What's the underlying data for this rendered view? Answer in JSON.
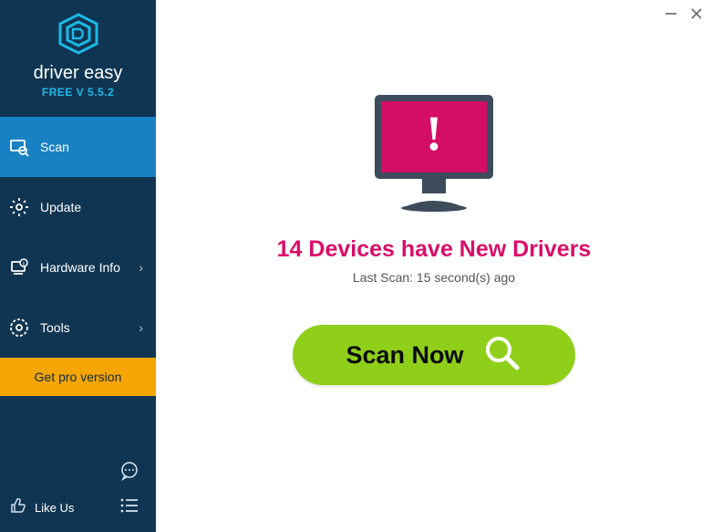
{
  "app": {
    "name": "driver easy",
    "version": "FREE V 5.5.2"
  },
  "sidebar": {
    "items": [
      {
        "label": "Scan",
        "icon": "scan-icon"
      },
      {
        "label": "Update",
        "icon": "gear-icon"
      },
      {
        "label": "Hardware Info",
        "icon": "hardware-info-icon"
      },
      {
        "label": "Tools",
        "icon": "tools-icon"
      }
    ],
    "get_pro": "Get pro version",
    "like_us": "Like Us"
  },
  "main": {
    "headline": "14 Devices have New Drivers",
    "last_scan": "Last Scan: 15 second(s) ago",
    "scan_button": "Scan Now"
  },
  "colors": {
    "sidebar": "#103552",
    "active": "#1881c4",
    "accent_pink": "#d90d6a",
    "gold": "#f5a605",
    "scan_green": "#8fcf1a"
  }
}
